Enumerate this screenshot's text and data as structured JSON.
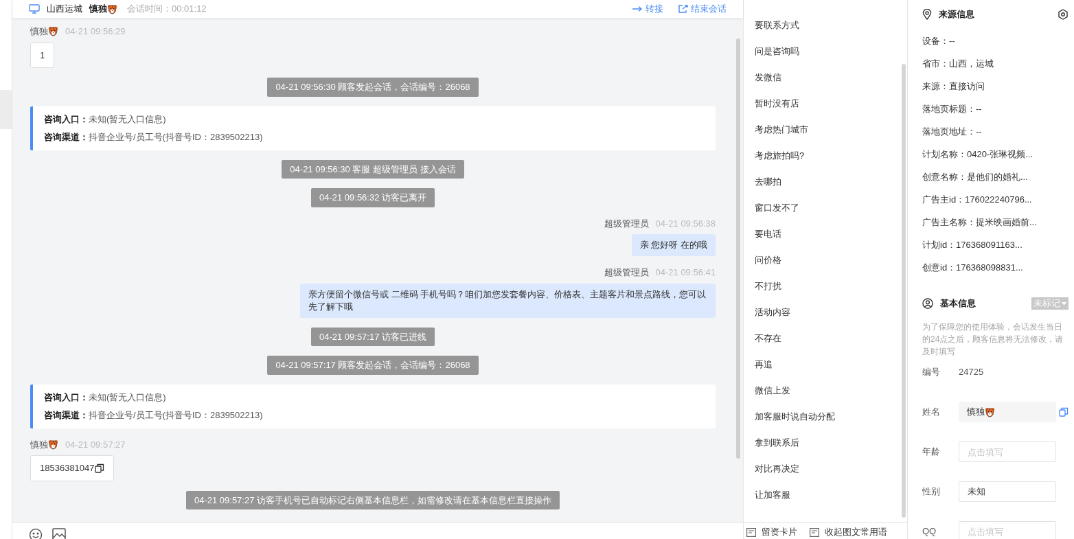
{
  "header": {
    "location": "山西运城",
    "visitor_name": "慎独",
    "session_time": "会话时间：00:01:12",
    "actions": [
      {
        "kind": "transfer",
        "label": "转接"
      },
      {
        "kind": "end",
        "label": "结束会话"
      }
    ]
  },
  "messages": [
    {
      "kind": "visitor",
      "sender": "慎独",
      "time": "04-21 09:56:29",
      "text": "1",
      "copy": false
    },
    {
      "kind": "system",
      "text": "04-21 09:56:30 顾客发起会话，会话编号：26068"
    },
    {
      "kind": "source_card",
      "fields": [
        {
          "label": "咨询入口：",
          "value": "未知(暂无入口信息)"
        },
        {
          "label": "咨询渠道：",
          "value": "抖音企业号/员工号(抖音号ID：2839502213)"
        }
      ]
    },
    {
      "kind": "system",
      "text": "04-21 09:56:30 客服 超级管理员 接入会话"
    },
    {
      "kind": "system",
      "text": "04-21 09:56:32 访客已离开"
    },
    {
      "kind": "agent",
      "sender": "超级管理员",
      "time": "04-21 09:56:38",
      "text": "亲 您好呀 在的哦"
    },
    {
      "kind": "agent",
      "sender": "超级管理员",
      "time": "04-21 09:56:41",
      "text": "亲方便留个微信号或 二维码 手机号吗？咱们加您发套餐内容、价格表、主题客片和景点路线，您可以先了解下哦"
    },
    {
      "kind": "system",
      "text": "04-21 09:57:17 访客已进线"
    },
    {
      "kind": "system",
      "text": "04-21 09:57:17 顾客发起会话，会话编号：26068"
    },
    {
      "kind": "source_card",
      "fields": [
        {
          "label": "咨询入口：",
          "value": "未知(暂无入口信息)"
        },
        {
          "label": "咨询渠道：",
          "value": "抖音企业号/员工号(抖音号ID：2839502213)"
        }
      ]
    },
    {
      "kind": "visitor",
      "sender": "慎独",
      "time": "04-21 09:57:27",
      "text": "18536381047",
      "copy": true
    },
    {
      "kind": "system",
      "text": "04-21 09:57:27 访客手机号已自动标记右侧基本信息栏，如需修改请在基本信息栏直接操作"
    }
  ],
  "quick_replies": [
    "要联系方式",
    "问是咨询吗",
    "发微信",
    "暂时没有店",
    "考虑热门城市",
    "考虑旅拍吗?",
    "去哪拍",
    "窗口发不了",
    "要电话",
    "问价格",
    "不打扰",
    "活动内容",
    "不存在",
    "再追",
    "微信上发",
    "加客服时说自动分配",
    "拿到联系后",
    "对比再决定",
    "让加客服"
  ],
  "footer_actions": [
    "留资卡片",
    "收起图文常用语"
  ],
  "source_info": {
    "title": "来源信息",
    "lines": [
      "设备：--",
      "省市：山西，运城",
      "来源：直接访问",
      "落地页标题：--",
      "落地页地址：--",
      "计划名称：0420-张琳视频...",
      "创意名称：是他们的婚礼...",
      "广告主id：176022240796...",
      "广告主名称：提米映画婚前...",
      "计划id：176368091163...",
      "创意id：176368098831..."
    ]
  },
  "basic_info": {
    "title": "基本信息",
    "tag": "未标记",
    "notice": "为了保障您的使用体验，会话发生当日的24点之后，顾客信息将无法修改，请及时填写",
    "fields": [
      {
        "kind": "text",
        "label": "编号",
        "value": "24725"
      },
      {
        "kind": "name",
        "label": "姓名",
        "value": "慎独"
      },
      {
        "kind": "input",
        "label": "年龄",
        "placeholder": "点击填写"
      },
      {
        "kind": "input",
        "label": "性别",
        "value": "未知"
      },
      {
        "kind": "input",
        "label": "QQ",
        "placeholder": "点击填写"
      }
    ]
  }
}
